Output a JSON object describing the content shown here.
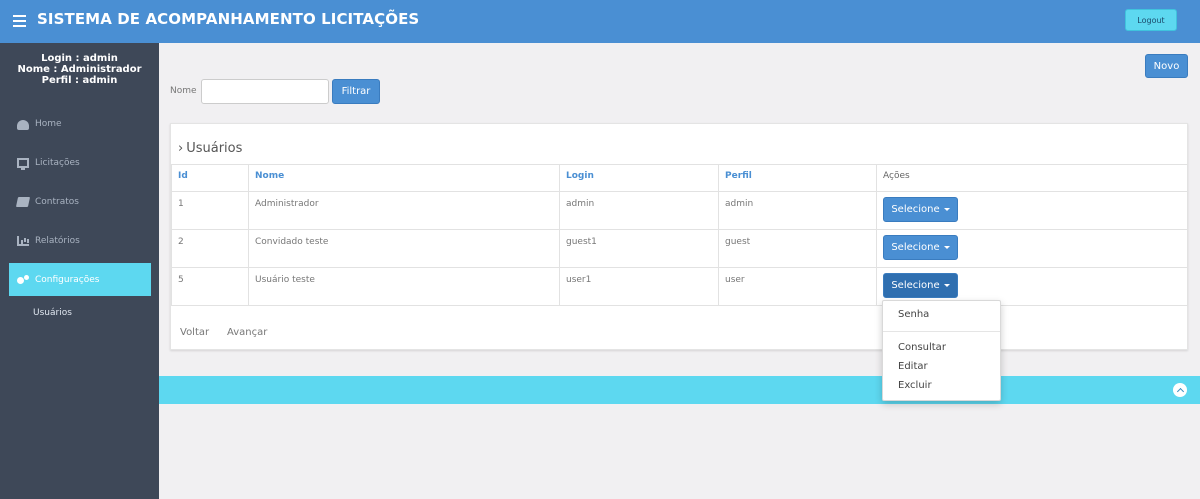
{
  "header": {
    "title": "SISTEMA DE ACOMPANHAMENTO LICITAÇÕES",
    "logout_label": "Logout",
    "menu_icon": "hamburger-icon",
    "colors": {
      "header": "#4a8fd3",
      "accent": "#5dd8f0",
      "sidebar": "#3e4858"
    }
  },
  "sidebar": {
    "user": {
      "login": "Login : admin",
      "nome": "Nome : Administrador",
      "perfil": "Perfil : admin"
    },
    "items": [
      {
        "label": "Home",
        "icon": "dashboard-icon"
      },
      {
        "label": "Licitações",
        "icon": "monitor-icon"
      },
      {
        "label": "Contratos",
        "icon": "book-icon"
      },
      {
        "label": "Relatórios",
        "icon": "bar-chart-icon"
      },
      {
        "label": "Configurações",
        "icon": "gears-icon",
        "active": true
      }
    ],
    "subitem": "Usuários"
  },
  "toolbar": {
    "novo_label": "Novo",
    "filter_label": "Nome",
    "filter_value": "",
    "filter_button": "Filtrar"
  },
  "panel": {
    "title": "Usuários",
    "columns": [
      "Id",
      "Nome",
      "Login",
      "Perfil",
      "Ações"
    ],
    "rows": [
      {
        "id": "1",
        "nome": "Administrador",
        "login": "admin",
        "perfil": "admin",
        "acao": "Selecione"
      },
      {
        "id": "2",
        "nome": "Convidado teste",
        "login": "guest1",
        "perfil": "guest",
        "acao": "Selecione"
      },
      {
        "id": "5",
        "nome": "Usuário teste",
        "login": "user1",
        "perfil": "user",
        "acao": "Selecione"
      }
    ],
    "pager": {
      "prev": "Voltar",
      "next": "Avançar"
    }
  },
  "dropdown": {
    "items": [
      "Senha",
      "Consultar",
      "Editar",
      "Excluir"
    ]
  }
}
